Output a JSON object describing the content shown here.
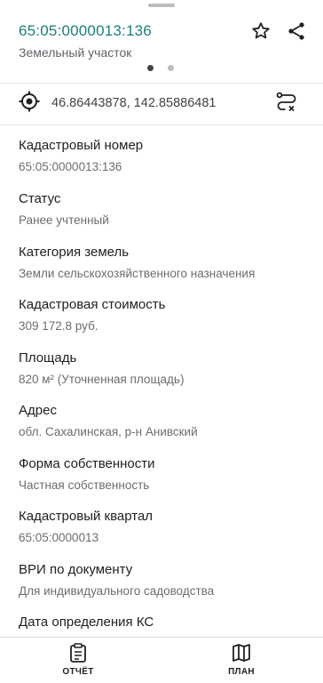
{
  "header": {
    "cadastral_number": "65:05:0000013:136",
    "object_type": "Земельный участок",
    "star_icon": "star-outline-icon",
    "share_icon": "share-icon",
    "pager": {
      "pages": 2,
      "active": 0
    }
  },
  "location": {
    "coordinates": "46.86443878, 142.85886481",
    "target_icon": "gps-target-icon",
    "route_icon": "route-icon"
  },
  "fields": [
    {
      "label": "Кадастровый номер",
      "value": "65:05:0000013:136"
    },
    {
      "label": "Статус",
      "value": "Ранее учтенный"
    },
    {
      "label": "Категория земель",
      "value": "Земли сельскохозяйственного назначения"
    },
    {
      "label": "Кадастровая стоимость",
      "value": "309 172.8 руб."
    },
    {
      "label": "Площадь",
      "value": "820 м² (Уточненная площадь)"
    },
    {
      "label": "Адрес",
      "value": "обл. Сахалинская, р-н Анивский"
    },
    {
      "label": "Форма собственности",
      "value": "Частная собственность"
    },
    {
      "label": "Кадастровый квартал",
      "value": "65:05:0000013"
    },
    {
      "label": "ВРИ по документу",
      "value": "Для индивидуального садоводства"
    },
    {
      "label": "Дата определения КС",
      "value": ""
    }
  ],
  "bottom_bar": {
    "report_label": "ОТЧЁТ",
    "plan_label": "ПЛАН"
  },
  "colors": {
    "accent": "#1b7f7a",
    "label": "#212121",
    "value": "#6d6d6d"
  }
}
